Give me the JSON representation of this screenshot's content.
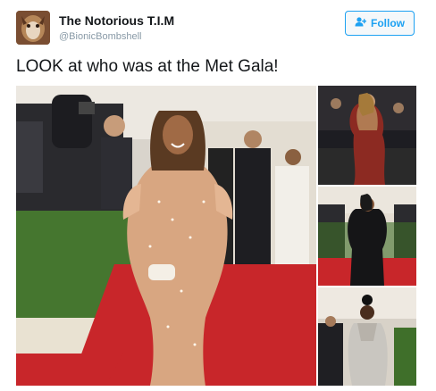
{
  "tweet": {
    "display_name": "The Notorious T.I.M",
    "handle": "@BionicBombshell",
    "text": "LOOK at who was at the Met Gala!",
    "follow_label": "Follow",
    "follow_icon": "add-user-icon"
  },
  "colors": {
    "accent": "#1da1f2",
    "name_text": "#14171a",
    "handle_text": "#8899a6",
    "red_carpet": "#c8262a",
    "hedge_green": "#3f6f2a"
  },
  "media": {
    "photos": [
      {
        "name": "photo-main"
      },
      {
        "name": "photo-2"
      },
      {
        "name": "photo-3"
      },
      {
        "name": "photo-4"
      }
    ]
  }
}
